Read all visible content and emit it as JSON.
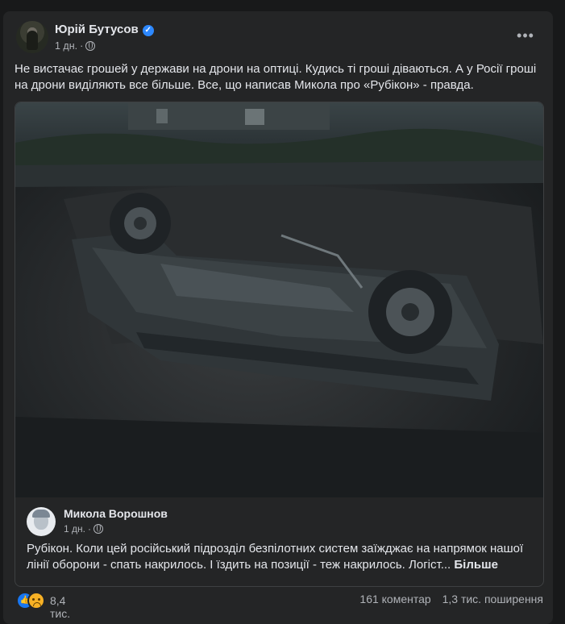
{
  "post": {
    "author": "Юрій Бутусов",
    "time": "1 дн.",
    "dot": "·",
    "more": "•••",
    "text": "Не вистачає грошей у держави на дрони на оптиці. Кудись ті гроші діваються. А у Росії гроші на дрони виділяють все більше. Все, що написав Микола про «Рубікон» - правда."
  },
  "shared": {
    "author": "Микола Ворошнов",
    "time": "1 дн.",
    "dot": "·",
    "text": "Рубікон. Коли цей російський підрозділ безпілотних систем заїжджає на напрямок нашої лінії оборони - спать накрилось. І їздить на позиції - теж накрилось. Логіст...",
    "more_label": "Більше"
  },
  "footer": {
    "reactions_count": "8,4 тис.",
    "comments": "161 коментар",
    "shares": "1,3 тис. поширення"
  },
  "colors": {
    "background": "#18191a",
    "card": "#242526",
    "accent": "#2d88ff"
  },
  "icons": [
    "verified-icon",
    "globe-icon",
    "more-icon",
    "like-reaction-icon",
    "sad-reaction-icon"
  ]
}
